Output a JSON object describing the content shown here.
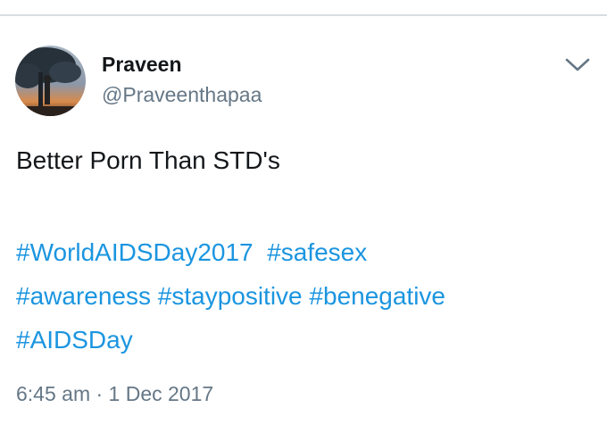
{
  "tweet": {
    "author": {
      "display_name": "Praveen",
      "handle": "@Praveenthapaa"
    },
    "caret_icon": "chevron-down-icon",
    "text": "Better Porn Than STD's",
    "hashtags": [
      "#WorldAIDSDay2017",
      "#safesex",
      "#awareness",
      "#staypositive",
      "#benegative",
      "#AIDSDay"
    ],
    "timestamp": "6:45 am · 1 Dec 2017"
  },
  "colors": {
    "link": "#1b95e0",
    "text": "#14171a",
    "muted": "#657786",
    "divider": "#d8dde2"
  }
}
